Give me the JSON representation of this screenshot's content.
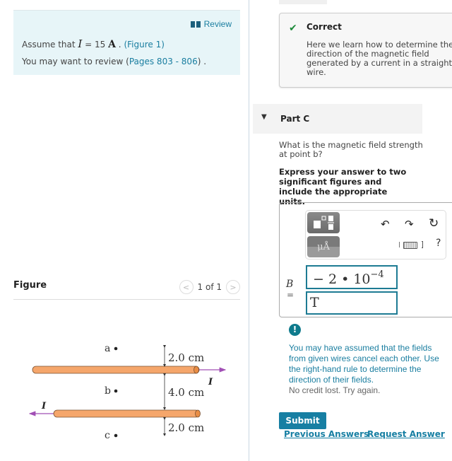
{
  "left": {
    "review_label": "Review",
    "assume_prefix": "Assume that ",
    "assume_var": "I",
    "assume_eq": " = 15 ",
    "assume_unit": "A",
    "assume_suffix": " . ",
    "figure_link": "(Figure 1)",
    "review_prefix": "You may want to review ",
    "pages_link_open": "(",
    "pages_link": "Pages 803 - 806",
    "pages_link_close": ") .",
    "figure_title": "Figure",
    "pager_text": "1 of 1",
    "prev_glyph": "<",
    "next_glyph": ">"
  },
  "figure": {
    "points": [
      "a",
      "b",
      "c"
    ],
    "distances": [
      "2.0 cm",
      "4.0 cm",
      "2.0 cm"
    ],
    "current_label": "I",
    "wire_color": "#f5a66b",
    "arrow_color": "#a14fb5"
  },
  "right": {
    "correct": {
      "title": "Correct",
      "text": "Here we learn how to determine the direction of the magnetic field generated by a current in a straight wire."
    },
    "part": {
      "title": "Part C",
      "question": "What is the magnetic field strength at point b?",
      "instruction": "Express your answer to two significant figures and include the appropriate units."
    },
    "toolbar": {
      "units_glyph": "μÅ",
      "undo_glyph": "↶",
      "redo_glyph": "↷",
      "reset_glyph": "↻",
      "help_glyph": "?"
    },
    "answer": {
      "var_label": "B",
      "eq_label": "=",
      "value_base": "− 2 • 10",
      "value_exp": "−4",
      "unit": "T"
    },
    "feedback": {
      "icon": "!",
      "message": "You may have assumed that the fields from given wires cancel each other. Use the right-hand rule to determine the direction of their fields.",
      "note": "No credit lost. Try again."
    },
    "actions": {
      "submit": "Submit",
      "previous": "Previous Answers",
      "request": "Request Answer"
    }
  },
  "colors": {
    "accent": "#177fa3",
    "success": "#1d8a3a",
    "info_bg": "#e7f5f8"
  }
}
